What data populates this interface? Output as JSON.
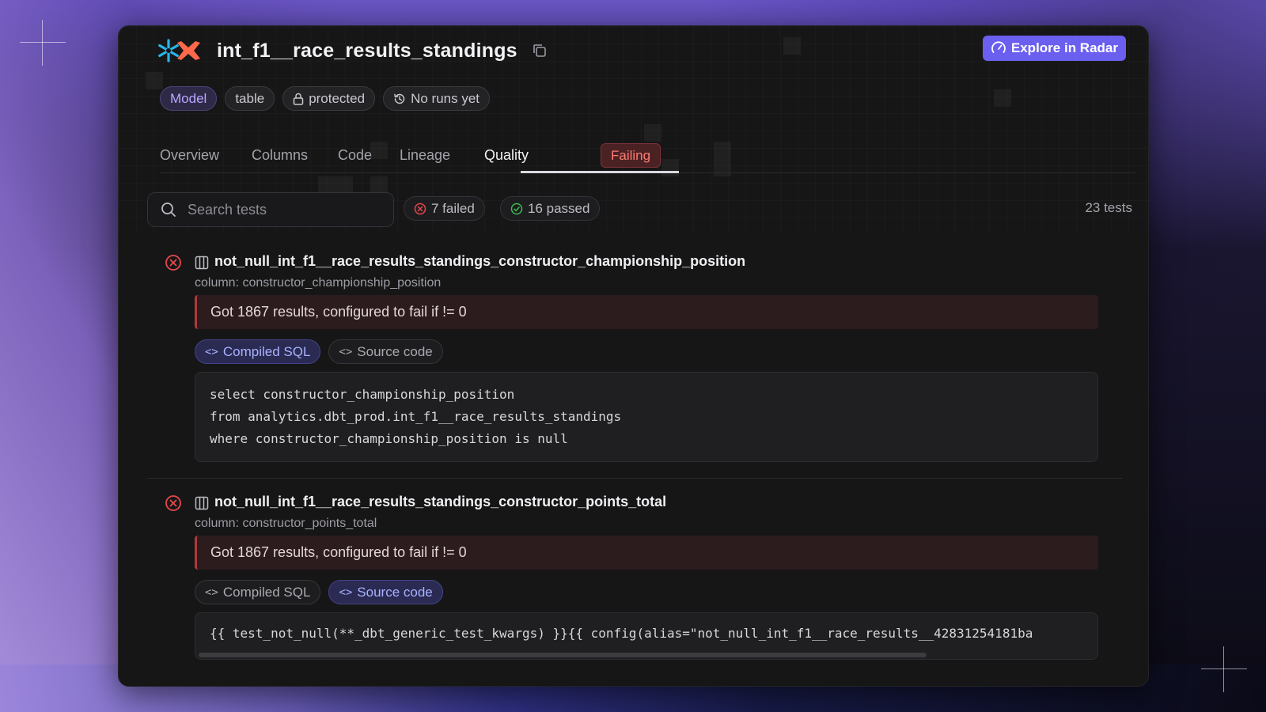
{
  "model": {
    "title": "int_f1__race_results_standings",
    "explore_label": "Explore in Radar",
    "badges": {
      "type": "Model",
      "materialization": "table",
      "access": "protected",
      "runs": "No runs yet"
    }
  },
  "tabs": {
    "overview": "Overview",
    "columns": "Columns",
    "code": "Code",
    "lineage": "Lineage",
    "quality": "Quality",
    "quality_status": "Failing"
  },
  "filters": {
    "search_placeholder": "Search tests",
    "failed": "7 failed",
    "passed": "16 passed",
    "total": "23 tests"
  },
  "tests": [
    {
      "name": "not_null_int_f1__race_results_standings_constructor_championship_position",
      "column": "column: constructor_championship_position",
      "error": "Got 1867 results, configured to fail if != 0",
      "compiled_label": "Compiled SQL",
      "source_label": "Source code",
      "active_view": "Compiled SQL",
      "code": [
        "select constructor_championship_position",
        "from analytics.dbt_prod.int_f1__race_results_standings",
        "where constructor_championship_position is null"
      ]
    },
    {
      "name": "not_null_int_f1__race_results_standings_constructor_points_total",
      "column": "column: constructor_points_total",
      "error": "Got 1867 results, configured to fail if != 0",
      "compiled_label": "Compiled SQL",
      "source_label": "Source code",
      "active_view": "Source code",
      "code": [
        "{{ test_not_null(**_dbt_generic_test_kwargs) }}{{ config(alias=\"not_null_int_f1__race_results__42831254181ba"
      ]
    }
  ],
  "colors": {
    "accent": "#6b5ff0",
    "fail": "#e5484d",
    "pass": "#3fb950"
  }
}
